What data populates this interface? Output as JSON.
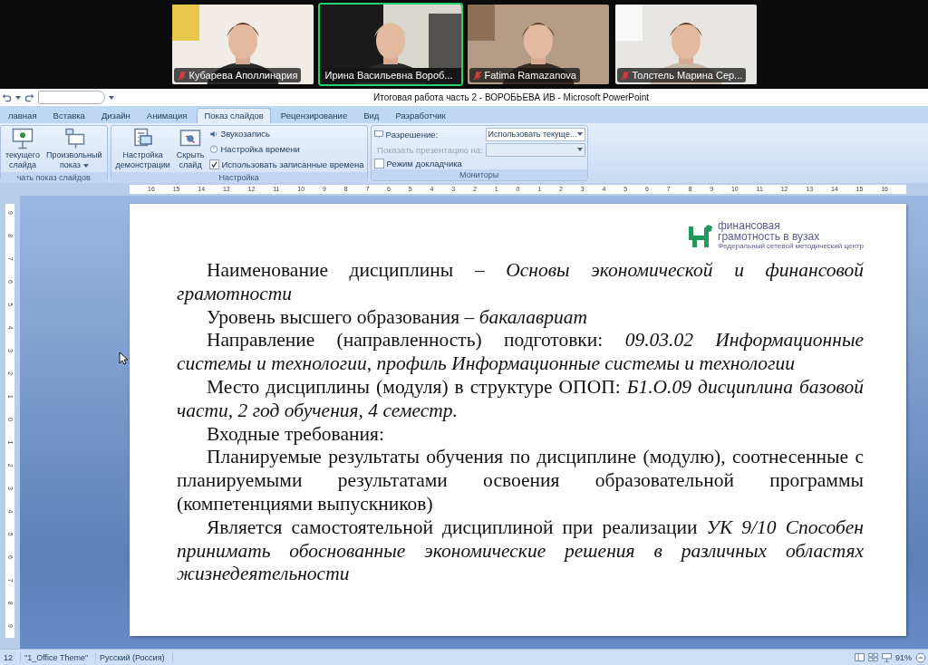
{
  "video_call": {
    "participants": [
      {
        "name": "Кубарева Аполлинария",
        "muted": true,
        "selected": false
      },
      {
        "name": "Ирина Васильевна Вороб...",
        "muted": false,
        "selected": true
      },
      {
        "name": "Fatima Ramazanova",
        "muted": true,
        "selected": false
      },
      {
        "name": "Толстель Марина Сер...",
        "muted": true,
        "selected": false
      }
    ]
  },
  "window": {
    "title": "Итоговая работа часть 2 - ВОРОБЬЕВА ИВ - Microsoft PowerPoint"
  },
  "tabs": [
    {
      "label": "лавная",
      "selected": false
    },
    {
      "label": "Вставка",
      "selected": false
    },
    {
      "label": "Дизайн",
      "selected": false
    },
    {
      "label": "Анимация",
      "selected": false
    },
    {
      "label": "Показ слайдов",
      "selected": true
    },
    {
      "label": "Рецензирование",
      "selected": false
    },
    {
      "label": "Вид",
      "selected": false
    },
    {
      "label": "Разработчик",
      "selected": false
    }
  ],
  "ribbon_groups": [
    {
      "label": "чать показ слайдов",
      "large": [
        {
          "label": "текущего слайда",
          "caret": false
        },
        {
          "label": "Произвольный показ",
          "caret": true
        }
      ]
    },
    {
      "label": "Настройка",
      "large": [
        {
          "label": "Настройка демонстрации",
          "caret": false
        },
        {
          "label": "Скрыть слайд",
          "caret": false
        }
      ],
      "small": [
        {
          "kind": "command",
          "label": "Звукозапись"
        },
        {
          "kind": "command",
          "label": "Настройка времени"
        },
        {
          "kind": "check",
          "label": "Использовать записанные времена",
          "checked": true
        }
      ]
    },
    {
      "label": "Мониторы",
      "small": [
        {
          "kind": "select",
          "label": "Разрешение:",
          "value": "Использовать текуще...",
          "disabled": false
        },
        {
          "kind": "select",
          "label": "Показать презентацию на:",
          "disabled": true
        },
        {
          "kind": "check",
          "label": "Режим докладчика",
          "checked": false
        }
      ]
    }
  ],
  "horizontal_ruler": "16 15 14 13 12 11 10 9 8 7 6 5 4 3 2 1 0 1 2 3 4 5 6 7 8 9 10 11 12 13 14 15 16",
  "vertical_ruler": "9 8 7 6 5 4 3 2 1 0 1 2 3 4 5 6 7 8 9",
  "slide": {
    "logo": {
      "title": "финансовая",
      "subtitle": "грамотность в вузах",
      "caption": "Федеральный сетевой методический центр"
    },
    "paragraphs": [
      "Наименование дисциплины – *Основы экономической и финансовой грамотности*",
      "Уровень высшего образования – *бакалавриат*",
      "Направление (направленность) подготовки: *09.03.02 Информационные системы и технологии, профиль Информационные системы и технологии*",
      "Место дисциплины (модуля) в структуре ОПОП: *Б1.О.09 дисциплина базовой части, 2 год обучения, 4 семестр.*",
      "Входные требования:",
      "Планируемые результаты обучения по дисциплине (модулю), соотнесенные с планируемыми результатами освоения образовательной программы (компетенциями выпускников)",
      "Является самостоятельной дисциплиной при реализации *УК 9/10 Способен принимать обоснованные экономические решения в различных областях жизнедеятельности*"
    ]
  },
  "status_bar": {
    "slide": "12",
    "theme": "\"1_Office Theme\"",
    "language": "Русский (Россия)",
    "zoom": "91%"
  }
}
